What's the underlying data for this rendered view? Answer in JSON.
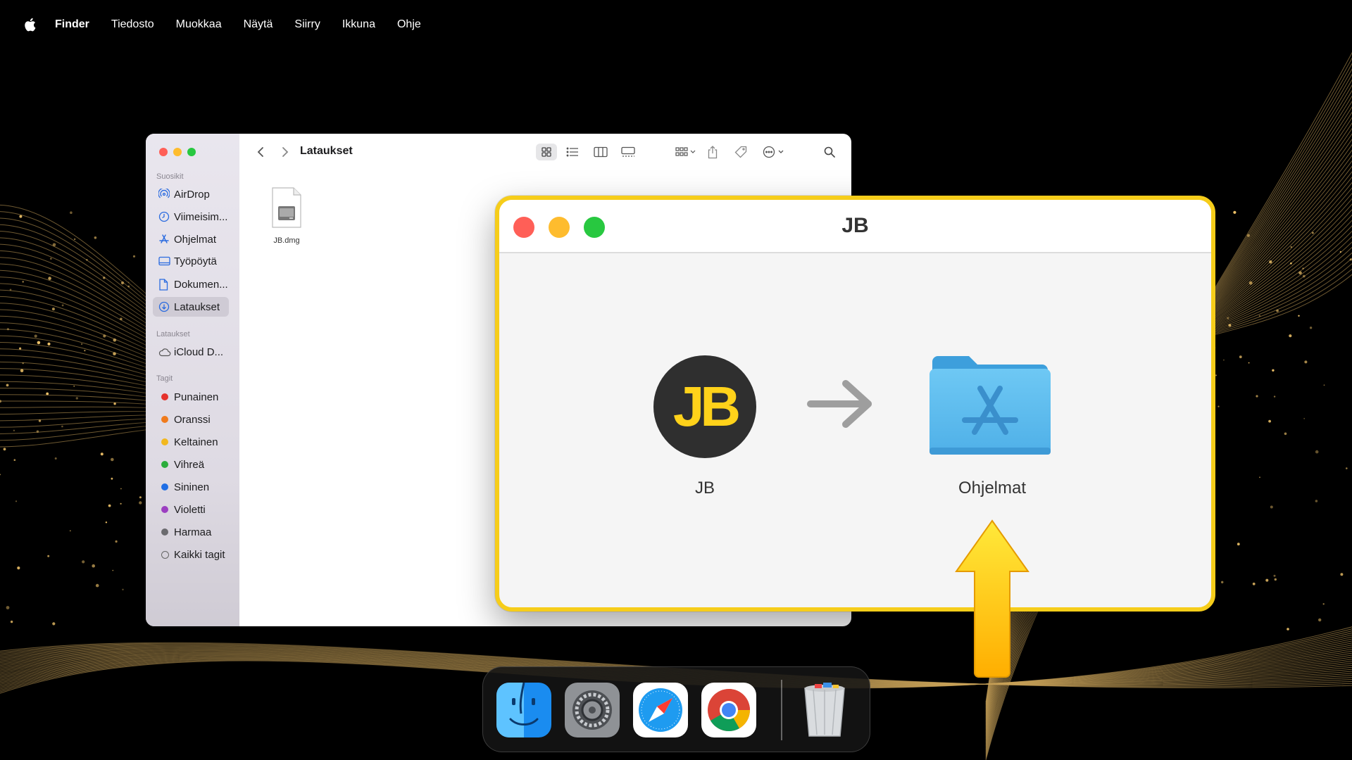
{
  "menubar": {
    "apple_icon": "apple-logo-icon",
    "items": [
      "Finder",
      "Tiedosto",
      "Muokkaa",
      "Näytä",
      "Siirry",
      "Ikkuna",
      "Ohje"
    ]
  },
  "finder": {
    "location_title": "Lataukset",
    "sections": {
      "favorites": "Suosikit",
      "locations": "Lataukset",
      "tags": "Tagit"
    },
    "favorites": [
      {
        "label": "AirDrop",
        "icon": "airdrop-icon"
      },
      {
        "label": "Viimeisim...",
        "icon": "clock-icon"
      },
      {
        "label": "Ohjelmat",
        "icon": "applications-icon"
      },
      {
        "label": "Työpöytä",
        "icon": "desktop-icon"
      },
      {
        "label": "Dokumen...",
        "icon": "document-icon"
      },
      {
        "label": "Lataukset",
        "icon": "download-icon",
        "active": true
      }
    ],
    "locations": [
      {
        "label": "iCloud D...",
        "icon": "cloud-icon"
      }
    ],
    "tags": [
      {
        "label": "Punainen",
        "color": "#e5322c"
      },
      {
        "label": "Oranssi",
        "color": "#f07b1d"
      },
      {
        "label": "Keltainen",
        "color": "#f2b81f"
      },
      {
        "label": "Vihreä",
        "color": "#2bad3c"
      },
      {
        "label": "Sininen",
        "color": "#1f6ee5"
      },
      {
        "label": "Violetti",
        "color": "#9c3fc1"
      },
      {
        "label": "Harmaa",
        "color": "#6b6b6f"
      },
      {
        "label": "Kaikki tagit",
        "color": "outline"
      }
    ],
    "file": {
      "name": "JB.dmg",
      "icon": "disk-image-icon"
    }
  },
  "dmg_window": {
    "title": "JB",
    "app_icon_text": "JB",
    "app_label": "JB",
    "folder_label": "Ohjelmat",
    "accent": "#f6cd1a"
  },
  "dock": {
    "apps": [
      "finder-icon",
      "system-settings-icon",
      "safari-icon",
      "chrome-icon"
    ],
    "trash": "trash-icon"
  }
}
